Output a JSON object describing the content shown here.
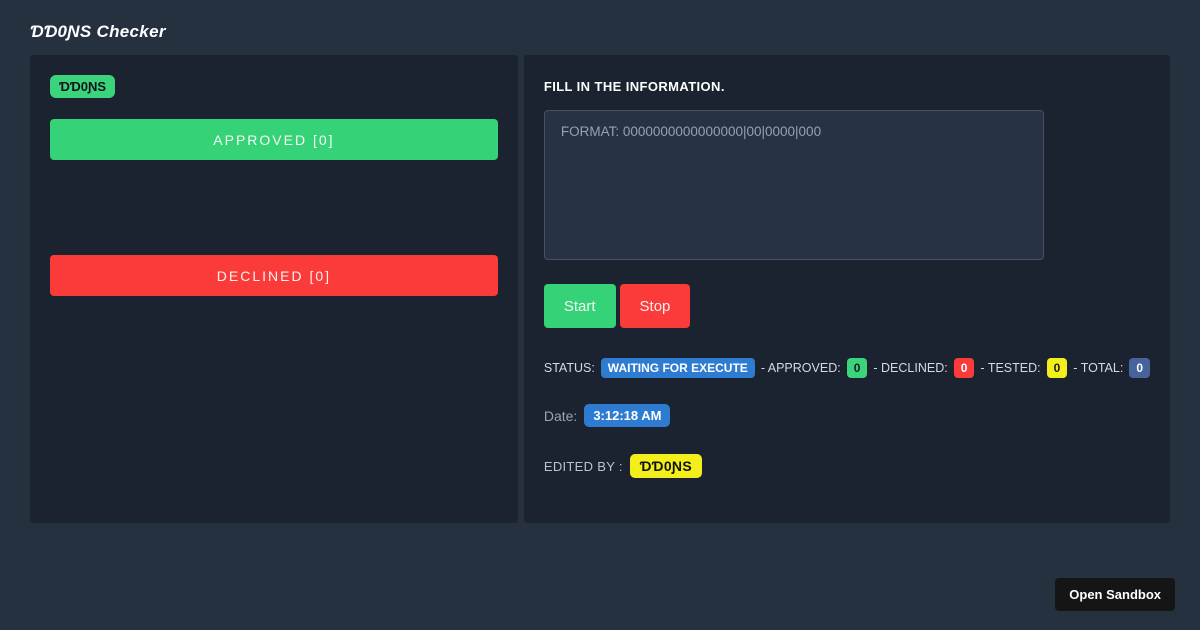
{
  "page": {
    "title": "ƊƊ0ƝS Checker"
  },
  "left_panel": {
    "brand_badge": "ƊƊ0ƝS",
    "approved_button": "APPROVED [0]",
    "declined_button": "DECLINED [0]"
  },
  "right_panel": {
    "heading": "FILL IN THE INFORMATION.",
    "textarea_placeholder": "FORMAT: 0000000000000000|00|0000|000",
    "textarea_value": "",
    "start_button": "Start",
    "stop_button": "Stop",
    "status": {
      "label": "STATUS:",
      "state_badge": "WAITING FOR EXECUTE",
      "approved_label": "- APPROVED:",
      "approved_count": "0",
      "declined_label": "- DECLINED:",
      "declined_count": "0",
      "tested_label": "- TESTED:",
      "tested_count": "0",
      "total_label": "- TOTAL:",
      "total_count": "0"
    },
    "date": {
      "label": "Date:",
      "value": "3:12:18 AM"
    },
    "edited_by": {
      "label": "EDITED BY :",
      "value": "ƊƊ0ƝS"
    }
  },
  "overlay": {
    "open_sandbox_button": "Open Sandbox"
  },
  "colors": {
    "page_background": "#263140",
    "panel_background": "#1b2330",
    "green": "#35d277",
    "red": "#fb3a3a",
    "blue": "#2e7cd2",
    "yellow": "#f3ef1d",
    "slate_blue": "#47639c",
    "sandbox_button": "#151515"
  }
}
